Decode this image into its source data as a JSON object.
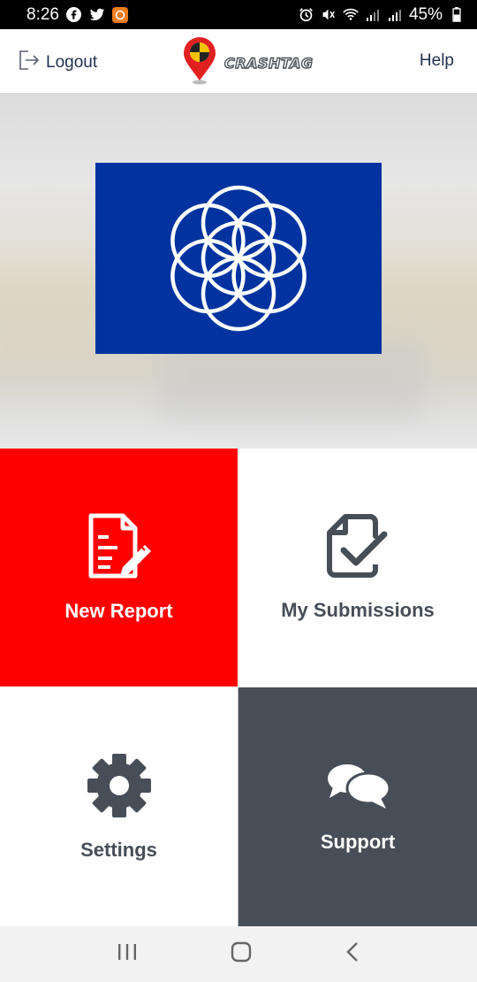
{
  "status_bar": {
    "time": "8:26",
    "battery_percent": "45%",
    "left_icons": [
      "facebook-icon",
      "twitter-icon",
      "notification-app-icon"
    ],
    "right_icons": [
      "alarm-icon",
      "mute-icon",
      "wifi-icon",
      "signal-icon",
      "signal-icon",
      "battery-icon"
    ]
  },
  "header": {
    "logout_label": "Logout",
    "brand_name": "CRASHTAG",
    "help_label": "Help"
  },
  "colors": {
    "new_report_bg": "#ff0000",
    "support_bg": "#474e57",
    "flag_blue": "#0033a0",
    "header_text": "#22314f"
  },
  "tiles": [
    {
      "label": "New Report",
      "icon": "report-edit-icon"
    },
    {
      "label": "My Submissions",
      "icon": "document-check-icon"
    },
    {
      "label": "Settings",
      "icon": "gear-icon"
    },
    {
      "label": "Support",
      "icon": "chat-bubbles-icon"
    }
  ],
  "nav_bar": {
    "icons": [
      "recent-apps-icon",
      "home-icon",
      "back-icon"
    ]
  }
}
